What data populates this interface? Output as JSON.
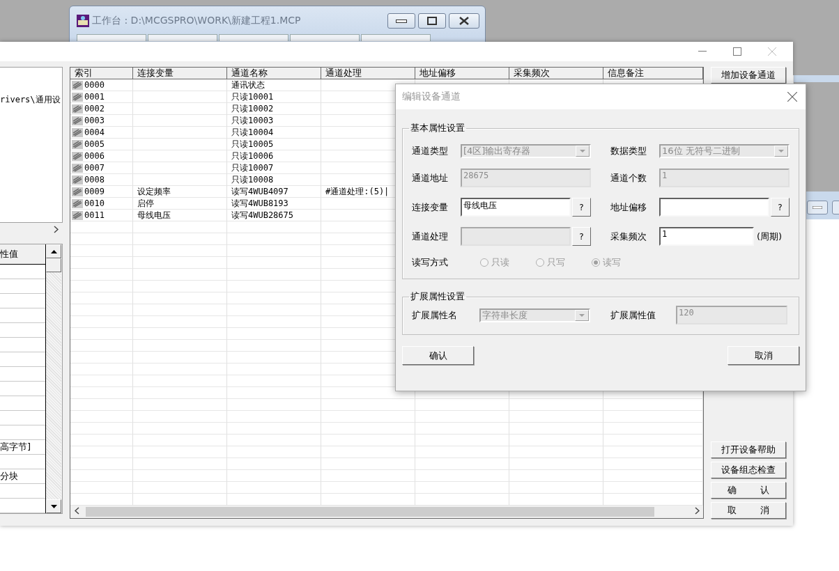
{
  "workbench_window": {
    "title": "工作台 : D:\\MCGSPRO\\WORK\\新建工程1.MCP"
  },
  "device_window": {
    "left_panel": {
      "path": "rivers\\通用设",
      "property_header": "性值",
      "property_rows": [
        {},
        {},
        {},
        {},
        {},
        {},
        {},
        {},
        {},
        {},
        {},
        {},
        {
          "value": "高字节]"
        },
        {},
        {
          "value": "分块"
        },
        {},
        {}
      ]
    },
    "channel_table": {
      "columns": [
        "索引",
        "连接变量",
        "通道名称",
        "通道处理",
        "地址偏移",
        "采集频次",
        "信息备注"
      ],
      "rows": [
        {
          "index": "0000",
          "name": "通讯状态"
        },
        {
          "index": "0001",
          "name": "只读10001"
        },
        {
          "index": "0002",
          "name": "只读10002"
        },
        {
          "index": "0003",
          "name": "只读10003"
        },
        {
          "index": "0004",
          "name": "只读10004"
        },
        {
          "index": "0005",
          "name": "只读10005"
        },
        {
          "index": "0006",
          "name": "只读10006"
        },
        {
          "index": "0007",
          "name": "只读10007"
        },
        {
          "index": "0008",
          "name": "只读10008"
        },
        {
          "index": "0009",
          "variable": "设定频率",
          "name": "读写4WUB4097",
          "processing": "#通道处理:(5)|"
        },
        {
          "index": "0010",
          "variable": "启停",
          "name": "读写4WUB8193"
        },
        {
          "index": "0011",
          "variable": "母线电压",
          "name": "读写4WUB28675"
        }
      ]
    },
    "side_buttons_top": [
      "增加设备通道"
    ],
    "side_buttons_bottom": [
      "打开设备帮助",
      "设备组态检查",
      "确        认",
      "取        消"
    ]
  },
  "dialog": {
    "title": "编辑设备通道",
    "basic_group": {
      "title": "基本属性设置",
      "fields": [
        {
          "kind": "select",
          "label": "通道类型",
          "value": "[4区]输出寄存器",
          "disabled": true
        },
        {
          "kind": "select",
          "label": "数据类型",
          "value": "16位 无符号二进制",
          "disabled": true
        },
        {
          "kind": "text",
          "label": "通道地址",
          "value": "28675",
          "disabled": true
        },
        {
          "kind": "text",
          "label": "通道个数",
          "value": "1",
          "disabled": true
        },
        {
          "kind": "browse",
          "label": "连接变量",
          "value": "母线电压",
          "button": "?",
          "disabled": false
        },
        {
          "kind": "browse",
          "label": "地址偏移",
          "button": "?",
          "disabled": false
        },
        {
          "kind": "browse",
          "label": "通道处理",
          "button": "?",
          "disabled": true
        },
        {
          "kind": "suffix",
          "label": "采集频次",
          "value": "1",
          "suffix": "(周期)",
          "disabled": false
        }
      ],
      "rw_mode": {
        "label": "读写方式",
        "options": [
          {
            "label": "只读",
            "selected": false,
            "disabled": true
          },
          {
            "label": "只写",
            "selected": false,
            "disabled": true
          },
          {
            "label": "读写",
            "selected": true,
            "disabled": true
          }
        ]
      }
    },
    "ext_group": {
      "title": "扩展属性设置",
      "fields": [
        {
          "kind": "select",
          "label": "扩展属性名",
          "value": "字符串长度",
          "disabled": true
        },
        {
          "kind": "text",
          "label": "扩展属性值",
          "value": "120",
          "disabled": true
        }
      ]
    },
    "buttons": [
      "确认",
      "取消"
    ]
  }
}
